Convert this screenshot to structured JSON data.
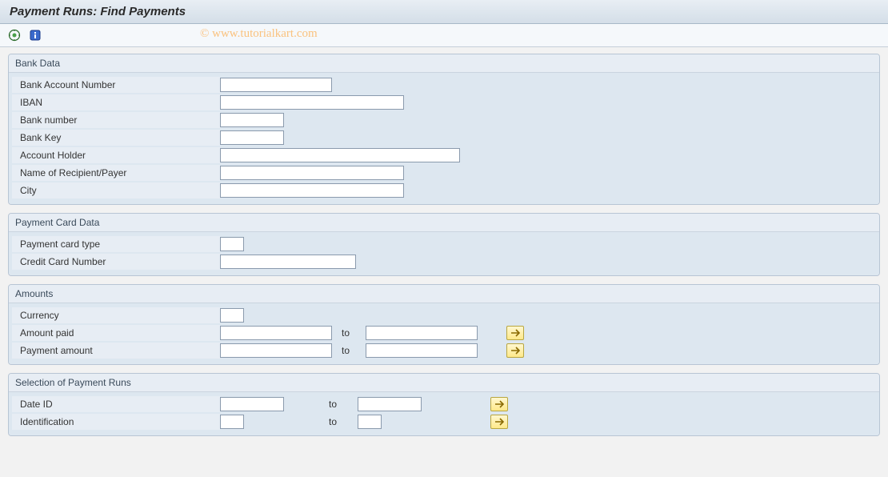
{
  "title": "Payment Runs: Find Payments",
  "watermark": "© www.tutorialkart.com",
  "groups": {
    "bankData": {
      "title": "Bank Data",
      "bankAccountNumber": {
        "label": "Bank Account Number",
        "value": ""
      },
      "iban": {
        "label": "IBAN",
        "value": ""
      },
      "bankNumber": {
        "label": "Bank number",
        "value": ""
      },
      "bankKey": {
        "label": "Bank Key",
        "value": ""
      },
      "accountHolder": {
        "label": "Account Holder",
        "value": ""
      },
      "recipientPayer": {
        "label": "Name of Recipient/Payer",
        "value": ""
      },
      "city": {
        "label": "City",
        "value": ""
      }
    },
    "paymentCard": {
      "title": "Payment Card Data",
      "cardType": {
        "label": "Payment card type",
        "value": ""
      },
      "cardNumber": {
        "label": "Credit Card Number",
        "value": ""
      }
    },
    "amounts": {
      "title": "Amounts",
      "toText": "to",
      "currency": {
        "label": "Currency",
        "value": ""
      },
      "amountPaid": {
        "label": "Amount paid",
        "from": "",
        "to": ""
      },
      "paymentAmount": {
        "label": "Payment amount",
        "from": "",
        "to": ""
      }
    },
    "selection": {
      "title": "Selection of Payment Runs",
      "toText": "to",
      "dateId": {
        "label": "Date ID",
        "from": "",
        "to": ""
      },
      "identification": {
        "label": "Identification",
        "from": "",
        "to": ""
      }
    }
  },
  "icons": {
    "execute": "execute-icon",
    "info": "info-icon",
    "range": "multiple-selection-icon"
  }
}
